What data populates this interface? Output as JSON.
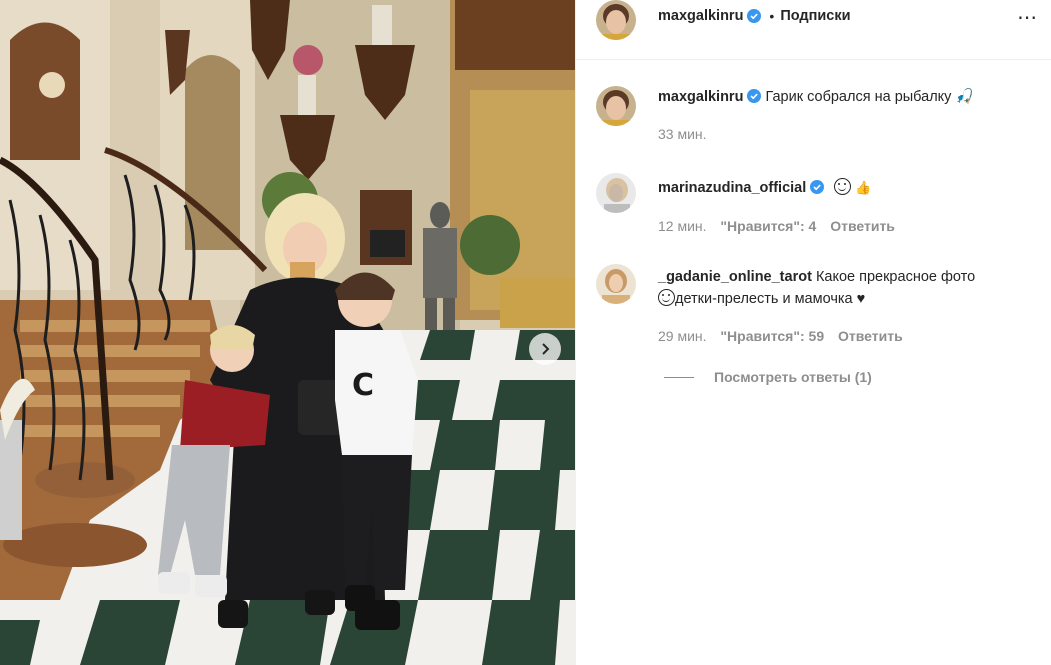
{
  "post": {
    "author": "maxgalkinru",
    "follow_separator": "•",
    "follow_label": "Подписки",
    "more_icon": "⋯"
  },
  "caption": {
    "author": "maxgalkinru",
    "text": "Гарик собрался на рыбалку 🎣",
    "time": "33 мин."
  },
  "comments": [
    {
      "author": "marinazudina_official",
      "text": "",
      "emoji": "👍",
      "time": "12 мин.",
      "likes_label": "\"Нравится\": 4",
      "reply_label": "Ответить"
    },
    {
      "author": "_gadanie_online_tarot",
      "text_line1": "Какое прекрасное фото",
      "text_line2": "детки-прелесть и мамочка ♥",
      "time": "29 мин.",
      "likes_label": "\"Нравится\": 59",
      "reply_label": "Ответить"
    }
  ],
  "view_replies_label": "Посмотреть ответы (1)",
  "colors": {
    "text": "#262626",
    "muted": "#8e8e8e",
    "verified": "#3897f0",
    "divider": "#efefef"
  }
}
